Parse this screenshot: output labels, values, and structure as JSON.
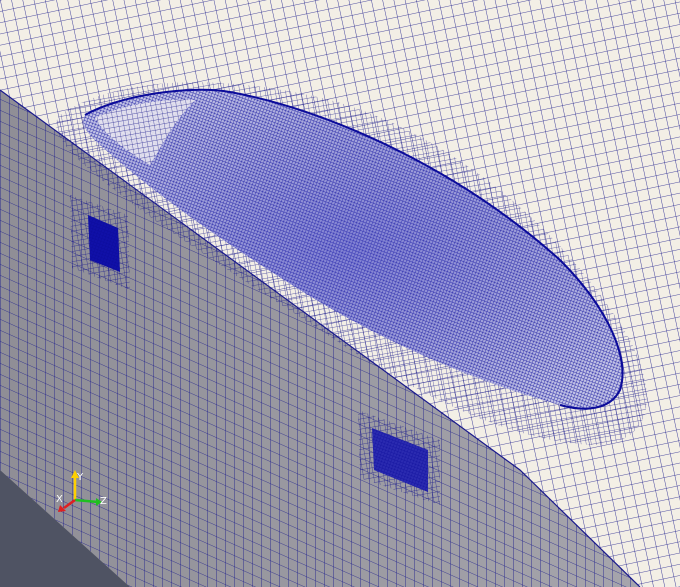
{
  "viewport": {
    "background": "#4f5363",
    "mesh_edge_color": "#1a1a8c",
    "dense_mesh_color": "#0b0b9a",
    "top_face_color": "#f3efe6",
    "side_face_color": "#f3efe6",
    "side_shade_color": "#8f8e96"
  },
  "orientation_axes": {
    "x_label": "X",
    "y_label": "Y",
    "z_label": "Z",
    "x_color": "#e02020",
    "y_color": "#ffd000",
    "z_color": "#20c020"
  }
}
